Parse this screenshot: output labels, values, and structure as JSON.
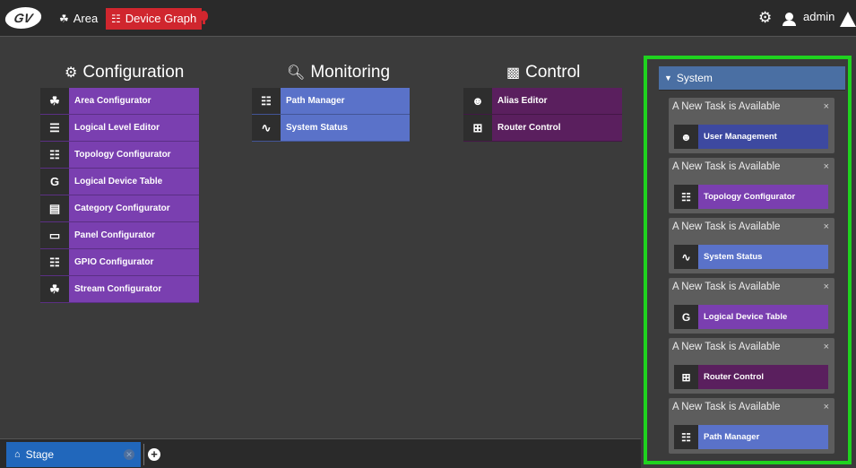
{
  "header": {
    "logo": "GV",
    "tabs": [
      {
        "label": "Area",
        "icon": "area-icon"
      },
      {
        "label": "Device Graph",
        "icon": "topology-icon"
      }
    ],
    "notification_icon": "bulb-icon",
    "settings_icon": "gear-icon",
    "user": "admin",
    "alert_icon": "warning-icon"
  },
  "sections": {
    "configuration": {
      "title": "Configuration",
      "items": [
        {
          "label": "Area Configurator",
          "icon": "area-icon"
        },
        {
          "label": "Logical Level Editor",
          "icon": "layers-icon"
        },
        {
          "label": "Topology Configurator",
          "icon": "topology-icon"
        },
        {
          "label": "Logical Device Table",
          "icon": "device-table-icon"
        },
        {
          "label": "Category Configurator",
          "icon": "category-icon"
        },
        {
          "label": "Panel Configurator",
          "icon": "panel-icon"
        },
        {
          "label": "GPIO Configurator",
          "icon": "gpio-icon"
        },
        {
          "label": "Stream Configurator",
          "icon": "stream-icon"
        }
      ]
    },
    "monitoring": {
      "title": "Monitoring",
      "items": [
        {
          "label": "Path Manager",
          "icon": "path-icon"
        },
        {
          "label": "System Status",
          "icon": "pulse-icon"
        }
      ]
    },
    "control": {
      "title": "Control",
      "items": [
        {
          "label": "Alias Editor",
          "icon": "alias-icon"
        },
        {
          "label": "Router Control",
          "icon": "grid-icon"
        }
      ]
    }
  },
  "system_panel": {
    "title": "System",
    "notifications": [
      {
        "title": "A New Task is Available",
        "task": "User Management",
        "color": "#3d49a0"
      },
      {
        "title": "A New Task is Available",
        "task": "Topology Configurator",
        "color": "#7a3fb0"
      },
      {
        "title": "A New Task is Available",
        "task": "System Status",
        "color": "#5a72c9"
      },
      {
        "title": "A New Task is Available",
        "task": "Logical Device Table",
        "color": "#7a3fb0"
      },
      {
        "title": "A New Task is Available",
        "task": "Router Control",
        "color": "#5a1f5e"
      },
      {
        "title": "A New Task is Available",
        "task": "Path Manager",
        "color": "#5a72c9"
      }
    ],
    "close_glyph": "×"
  },
  "footer": {
    "stage_label": "Stage",
    "add_tab_glyph": "+"
  },
  "colors": {
    "configuration": "#7a3fb0",
    "monitoring": "#5a72c9",
    "control": "#5a1f5e",
    "active_tab": "#d0262e",
    "highlight": "#1fd21f"
  }
}
